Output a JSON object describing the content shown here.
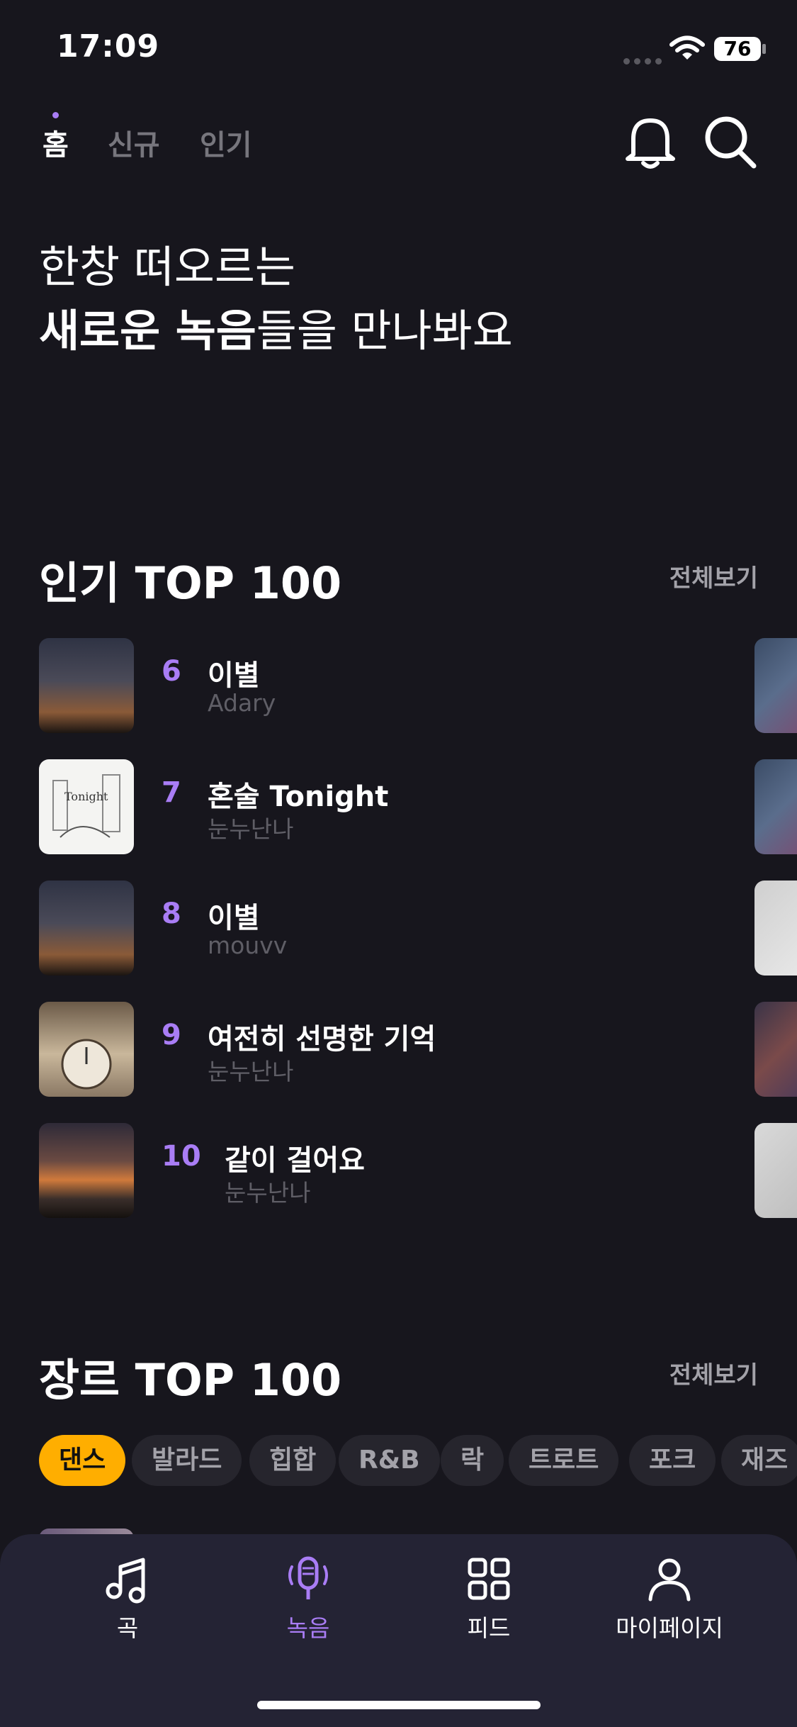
{
  "status_bar": {
    "time": "17:09",
    "battery": "76"
  },
  "top_tabs": [
    {
      "label": "홈",
      "active": true
    },
    {
      "label": "신규",
      "active": false
    },
    {
      "label": "인기",
      "active": false
    }
  ],
  "hero": {
    "line1": "한창 떠오르는",
    "line2_bold": "새로운 녹음",
    "line2_rest": "들을 만나봐요"
  },
  "popular": {
    "title": "인기 TOP 100",
    "see_all": "전체보기",
    "items": [
      {
        "rank": "6",
        "title": "이별",
        "artist": "Adary"
      },
      {
        "rank": "7",
        "title": "혼술 Tonight",
        "artist": "눈누난나"
      },
      {
        "rank": "8",
        "title": "이별",
        "artist": "mouvv"
      },
      {
        "rank": "9",
        "title": "여전히 선명한 기억",
        "artist": "눈누난나"
      },
      {
        "rank": "10",
        "title": "같이 걸어요",
        "artist": "눈누난나"
      }
    ]
  },
  "genre": {
    "title": "장르 TOP 100",
    "see_all": "전체보기",
    "chips": [
      "댄스",
      "발라드",
      "힙합",
      "R&B",
      "락",
      "트로트",
      "포크",
      "재즈"
    ],
    "active_chip": "댄스"
  },
  "bottom_nav": [
    {
      "label": "곡",
      "icon": "music-note-icon",
      "active": false
    },
    {
      "label": "녹음",
      "icon": "microphone-icon",
      "active": true
    },
    {
      "label": "피드",
      "icon": "feed-grid-icon",
      "active": false
    },
    {
      "label": "마이페이지",
      "icon": "profile-icon",
      "active": false
    }
  ],
  "colors": {
    "background": "#17161d",
    "accent": "#a97df5",
    "chip_active": "#ffae00",
    "nav_bg": "#242334"
  }
}
